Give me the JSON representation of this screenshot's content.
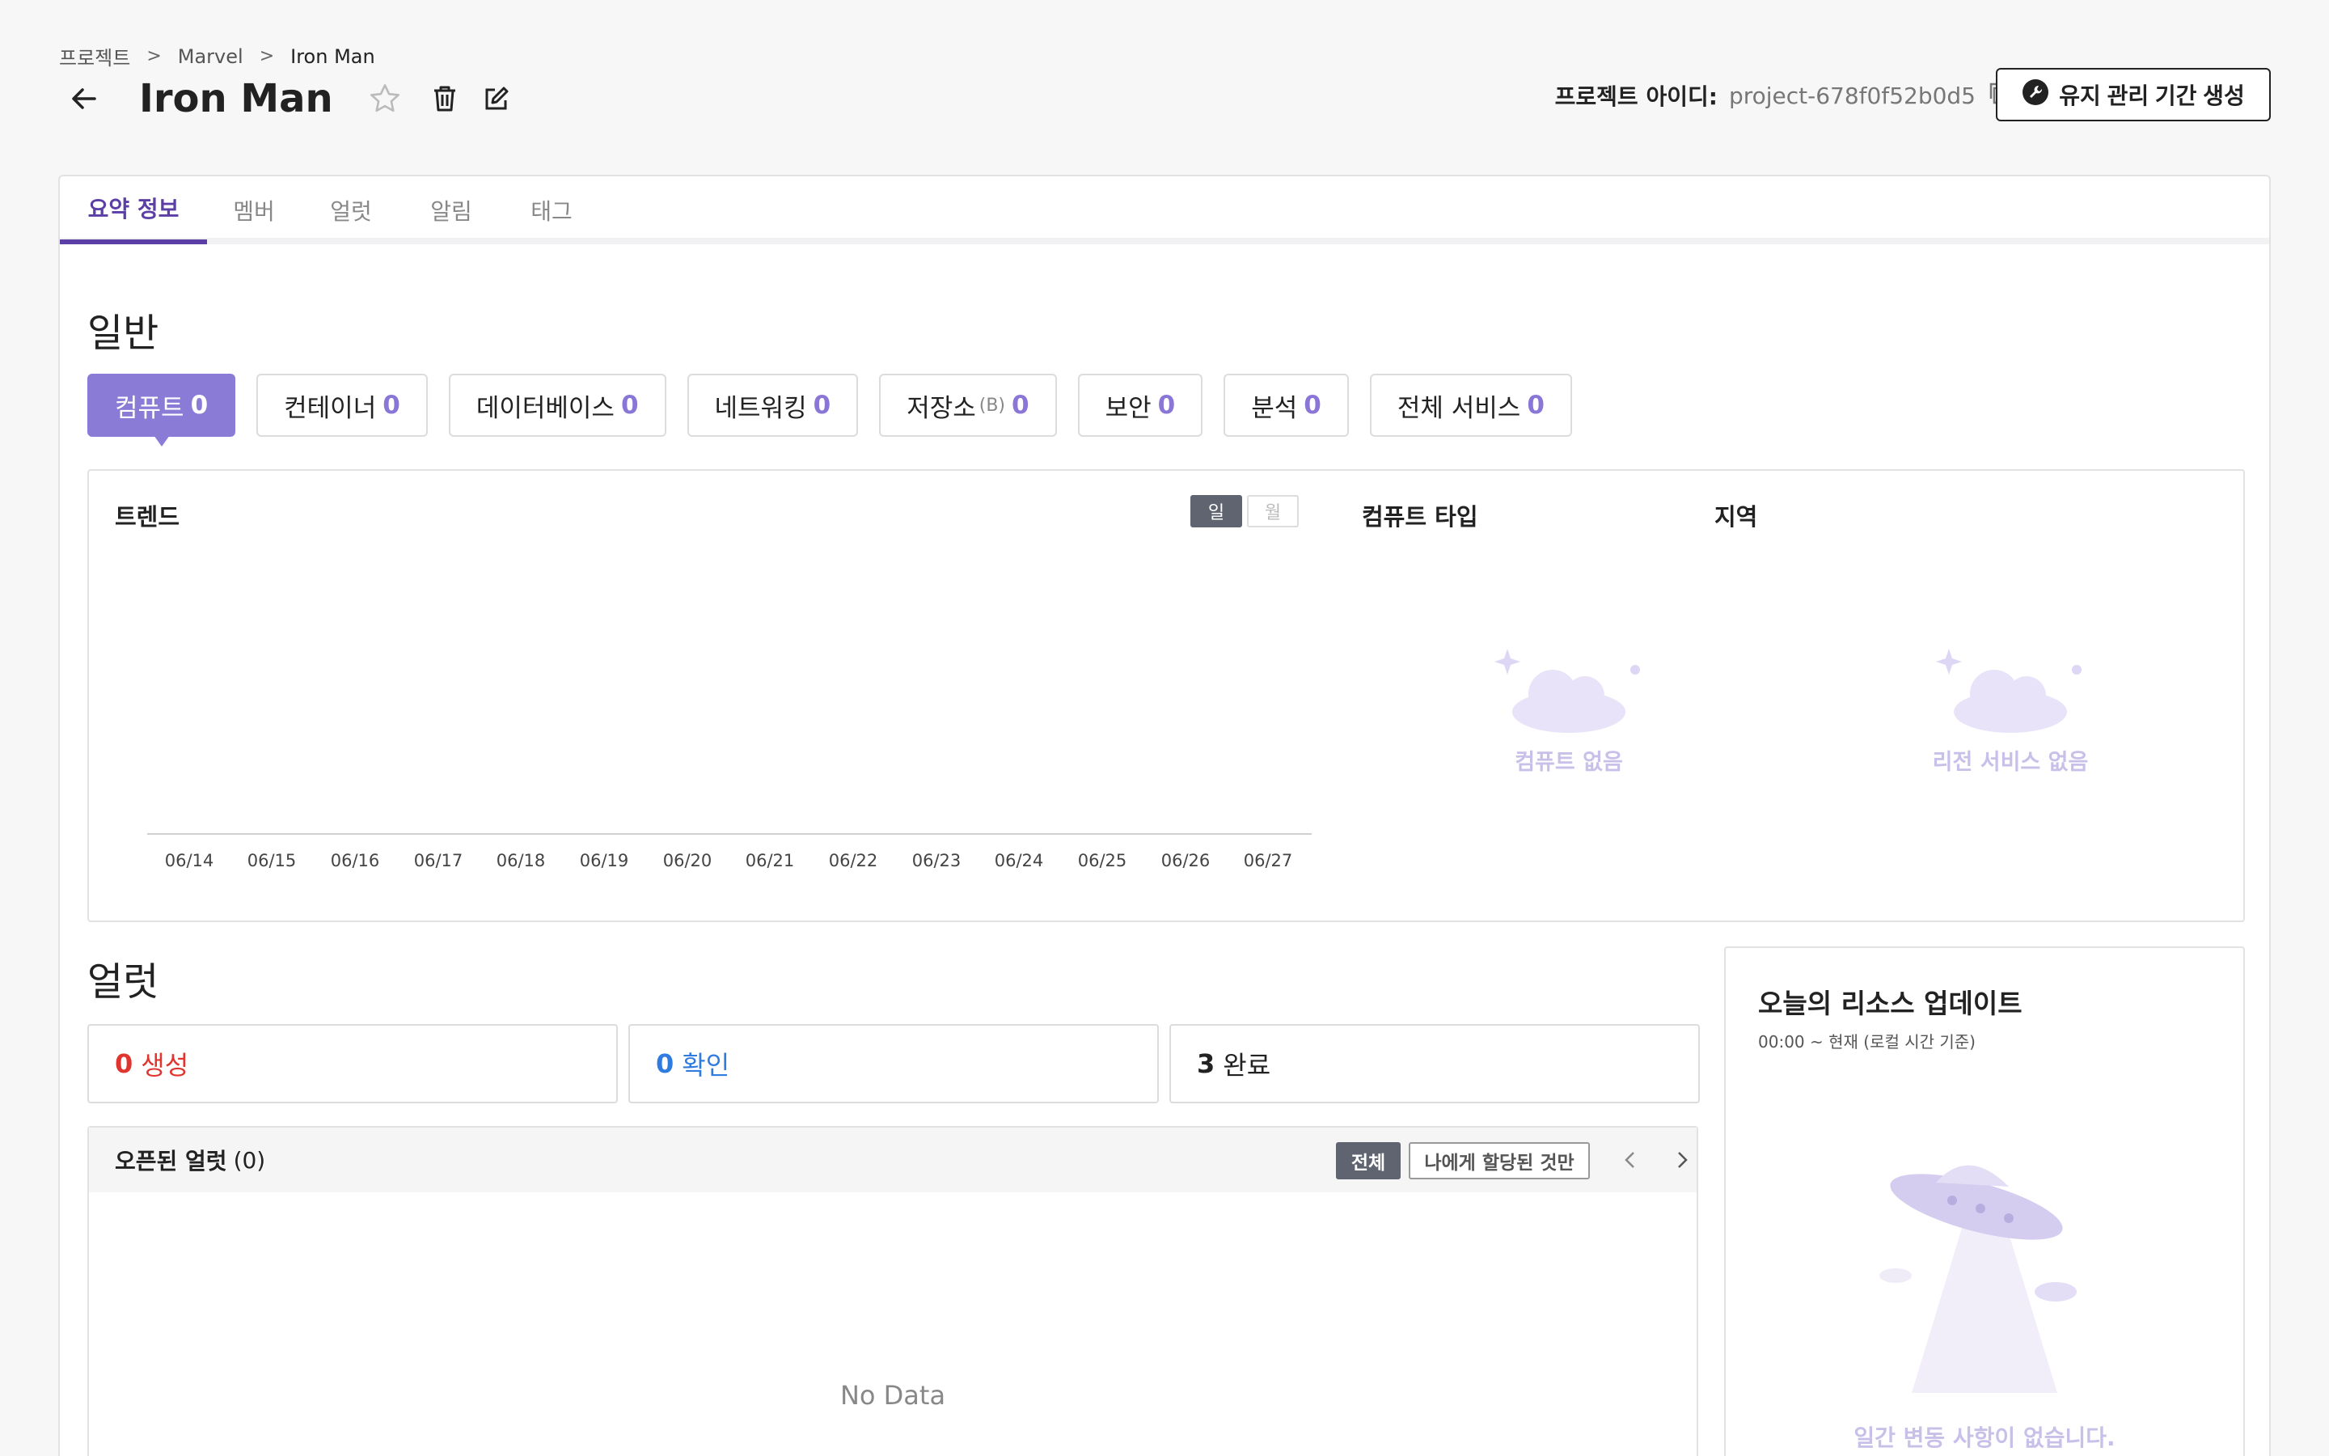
{
  "breadcrumb": {
    "root": "프로젝트",
    "group": "Marvel",
    "current": "Iron Man"
  },
  "header": {
    "title": "Iron Man",
    "project_id_label": "프로젝트 아이디:",
    "project_id_value": "project-678f0f52b0d5",
    "maintenance_button": "유지 관리 기간 생성"
  },
  "tabs": [
    "요약 정보",
    "멤버",
    "얼럿",
    "알림",
    "태그"
  ],
  "general": {
    "title": "일반",
    "categories": [
      {
        "label": "컴퓨트",
        "count": "0"
      },
      {
        "label": "컨테이너",
        "count": "0"
      },
      {
        "label": "데이터베이스",
        "count": "0"
      },
      {
        "label": "네트워킹",
        "count": "0"
      },
      {
        "label": "저장소",
        "sub": "(B)",
        "count": "0"
      },
      {
        "label": "보안",
        "count": "0"
      },
      {
        "label": "분석",
        "count": "0"
      },
      {
        "label": "전체 서비스",
        "count": "0"
      }
    ],
    "trend": {
      "title": "트렌드",
      "toggle_day": "일",
      "toggle_month": "월",
      "dates": [
        "06/14",
        "06/15",
        "06/16",
        "06/17",
        "06/18",
        "06/19",
        "06/20",
        "06/21",
        "06/22",
        "06/23",
        "06/24",
        "06/25",
        "06/26",
        "06/27"
      ]
    },
    "compute_type": {
      "title": "컴퓨트 타입",
      "empty": "컴퓨트 없음"
    },
    "region": {
      "title": "지역",
      "empty": "리전 서비스 없음"
    }
  },
  "alerts": {
    "title": "얼럿",
    "created": {
      "count": "0",
      "label": "생성"
    },
    "acknowledged": {
      "count": "0",
      "label": "확인"
    },
    "resolved": {
      "count": "3",
      "label": "완료"
    },
    "open_title": "오픈된 얼럿",
    "open_count": "(0)",
    "filter_all": "전체",
    "filter_mine": "나에게 할당된 것만",
    "no_data": "No Data"
  },
  "updates": {
    "title": "오늘의 리소스 업데이트",
    "subtitle": "00:00 ~ 현재 (로컬 시간 기준)",
    "empty": "일간 변동 사항이 없습니다."
  },
  "colors": {
    "accent": "#5b3fa6",
    "accent_light": "#8a7bd6",
    "created": "#e0342f",
    "acknowledged": "#2f7be0"
  }
}
